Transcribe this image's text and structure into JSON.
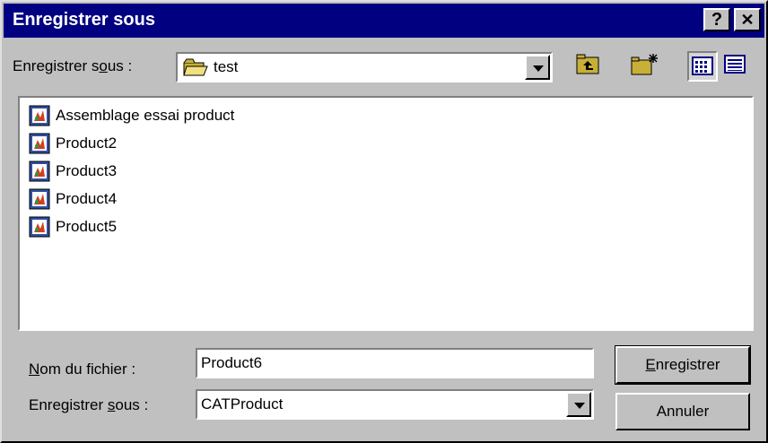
{
  "window": {
    "title": "Enregistrer sous",
    "help_label": "?",
    "close_label": "✕"
  },
  "location": {
    "label_prefix": "Enregistrer s",
    "label_mnemonic": "o",
    "label_suffix": "us :",
    "current_folder": "test"
  },
  "toolbar": {
    "buttons": [
      "up-one-level",
      "create-new-folder",
      "list-view",
      "details-view"
    ],
    "active": "list-view"
  },
  "files": [
    {
      "name": "Assemblage essai product"
    },
    {
      "name": "Product2"
    },
    {
      "name": "Product3"
    },
    {
      "name": "Product4"
    },
    {
      "name": "Product5"
    }
  ],
  "filename": {
    "label_mnemonic": "N",
    "label_rest": "om du fichier :",
    "value": "Product6"
  },
  "filetype": {
    "label_prefix": "Enregistrer ",
    "label_mnemonic": "s",
    "label_suffix": "ous :",
    "value": "CATProduct"
  },
  "buttons": {
    "save_mnemonic": "E",
    "save_rest": "nregistrer",
    "cancel": "Annuler"
  }
}
